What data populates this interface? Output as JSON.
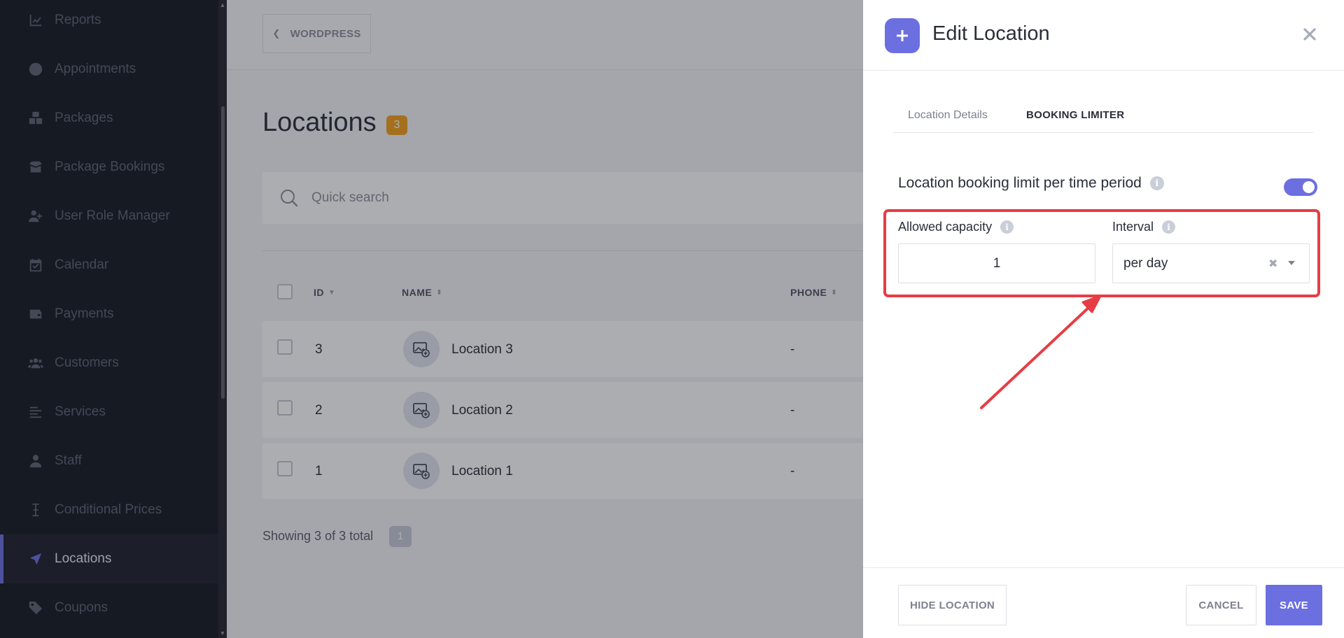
{
  "sidebar": {
    "items": [
      {
        "label": "Reports",
        "icon": "chart-line-icon"
      },
      {
        "label": "Appointments",
        "icon": "clock-icon"
      },
      {
        "label": "Packages",
        "icon": "boxes-icon"
      },
      {
        "label": "Package Bookings",
        "icon": "box-open-icon"
      },
      {
        "label": "User Role Manager",
        "icon": "user-plus-icon"
      },
      {
        "label": "Calendar",
        "icon": "calendar-check-icon"
      },
      {
        "label": "Payments",
        "icon": "wallet-icon"
      },
      {
        "label": "Customers",
        "icon": "users-icon"
      },
      {
        "label": "Services",
        "icon": "list-icon"
      },
      {
        "label": "Staff",
        "icon": "user-icon"
      },
      {
        "label": "Conditional Prices",
        "icon": "i-cursor-icon"
      },
      {
        "label": "Locations",
        "icon": "location-arrow-icon"
      },
      {
        "label": "Coupons",
        "icon": "tag-icon"
      }
    ],
    "active_index": 11
  },
  "main": {
    "wordpress_label": "WORDPRESS",
    "title": "Locations",
    "count": "3",
    "search_placeholder": "Quick search",
    "columns": {
      "id": "ID",
      "name": "NAME",
      "phone": "PHONE"
    },
    "rows": [
      {
        "id": "3",
        "name": "Location 3",
        "phone": "-"
      },
      {
        "id": "2",
        "name": "Location 2",
        "phone": "-"
      },
      {
        "id": "1",
        "name": "Location 1",
        "phone": "-"
      }
    ],
    "showing_text": "Showing 3 of 3 total",
    "page": "1"
  },
  "drawer": {
    "title": "Edit Location",
    "tabs": [
      {
        "label": "Location Details"
      },
      {
        "label": "BOOKING LIMITER"
      }
    ],
    "active_tab": 1,
    "limit_label": "Location booking limit per time period",
    "limit_enabled": true,
    "capacity_label": "Allowed capacity",
    "capacity_value": "1",
    "interval_label": "Interval",
    "interval_value": "per day",
    "hide_label": "HIDE LOCATION",
    "cancel_label": "CANCEL",
    "save_label": "SAVE"
  },
  "colors": {
    "accent": "#6b6fe0",
    "sidebar_bg": "#151922",
    "highlight": "#e73c44",
    "badge": "#f2a019"
  }
}
